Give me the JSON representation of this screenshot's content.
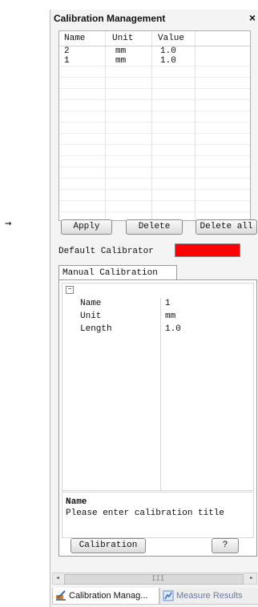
{
  "arrow": "→",
  "panel": {
    "title": "Calibration Management",
    "close": "×"
  },
  "table": {
    "headers": [
      "Name",
      "Unit",
      "Value"
    ],
    "rows": [
      [
        "2",
        "mm",
        "1.0"
      ],
      [
        "1",
        "mm",
        "1.0"
      ]
    ]
  },
  "buttons": {
    "apply": "Apply",
    "delete": "Delete",
    "delete_all": "Delete all"
  },
  "default_calibrator": {
    "label": "Default Calibrator",
    "color": "#ff0000"
  },
  "tab_manual": "Manual Calibration",
  "properties": {
    "collapse": "−",
    "rows": [
      {
        "label": "Name",
        "value": "1"
      },
      {
        "label": "Unit",
        "value": "mm"
      },
      {
        "label": "Length",
        "value": "1.0"
      }
    ]
  },
  "description": {
    "title": "Name",
    "text": "Please enter calibration title"
  },
  "calibration_button": "Calibration",
  "help_button": "?",
  "scroll": {
    "left": "◂",
    "right": "▸",
    "grip": "III"
  },
  "bottom_tabs": {
    "calibration": "Calibration Manag...",
    "measure": "Measure Results"
  }
}
